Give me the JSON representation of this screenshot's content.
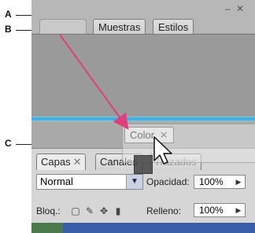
{
  "callouts": {
    "a": "A",
    "b": "B",
    "c": "C"
  },
  "window_controls": "– ✕",
  "dock_tabs": {
    "swatches": "Muestras",
    "styles": "Estilos"
  },
  "floating_tab": {
    "label": "Color",
    "close": "✕"
  },
  "bottom_tabs": {
    "layers": "Capas",
    "layers_close": "✕",
    "channels": "Canales",
    "paths": "Trazados"
  },
  "layers_panel": {
    "blend_mode": "Normal",
    "opacity_label": "Opacidad:",
    "opacity_value": "100%",
    "lock_label": "Bloq.:",
    "fill_label": "Relleno:",
    "fill_value": "100%"
  },
  "colors": {
    "drop_indicator": "#3fb2e8",
    "arrow": "#e0407a"
  },
  "icons": [
    "minimize-icon",
    "close-icon",
    "chevron-down-icon",
    "lock-transparent-icon",
    "lock-image-icon",
    "lock-move-icon",
    "lock-all-icon",
    "cursor-arrow-icon",
    "drag-arrow-icon"
  ]
}
